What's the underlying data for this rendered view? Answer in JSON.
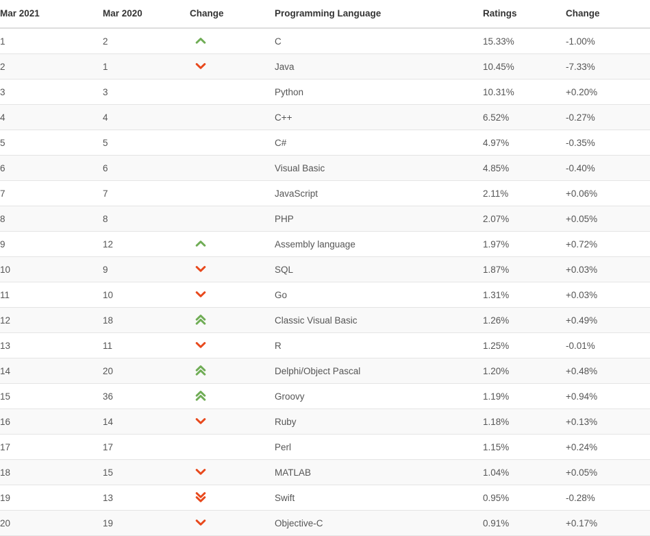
{
  "table": {
    "columns": [
      {
        "key": "rank2021",
        "label": "Mar 2021"
      },
      {
        "key": "rank2020",
        "label": "Mar 2020"
      },
      {
        "key": "change",
        "label": "Change"
      },
      {
        "key": "language",
        "label": "Programming Language"
      },
      {
        "key": "ratings",
        "label": "Ratings"
      },
      {
        "key": "delta",
        "label": "Change"
      }
    ],
    "colors": {
      "up_arrow": "#70ad56",
      "down_arrow": "#e8491d",
      "header_text": "#333333",
      "body_text": "#555555",
      "stripe": "#f9f9f9",
      "row_border": "#e4e4e4",
      "header_border": "#dddddd"
    },
    "icons": {
      "up_single": "chevron-up-icon",
      "up_double": "chevron-double-up-icon",
      "down_single": "chevron-down-icon",
      "down_double": "chevron-double-down-icon",
      "none": ""
    },
    "rows": [
      {
        "rank2021": "1",
        "rank2020": "2",
        "change": "up-single",
        "language": "C",
        "ratings": "15.33%",
        "delta": "-1.00%"
      },
      {
        "rank2021": "2",
        "rank2020": "1",
        "change": "down-single",
        "language": "Java",
        "ratings": "10.45%",
        "delta": "-7.33%"
      },
      {
        "rank2021": "3",
        "rank2020": "3",
        "change": "none",
        "language": "Python",
        "ratings": "10.31%",
        "delta": "+0.20%"
      },
      {
        "rank2021": "4",
        "rank2020": "4",
        "change": "none",
        "language": "C++",
        "ratings": "6.52%",
        "delta": "-0.27%"
      },
      {
        "rank2021": "5",
        "rank2020": "5",
        "change": "none",
        "language": "C#",
        "ratings": "4.97%",
        "delta": "-0.35%"
      },
      {
        "rank2021": "6",
        "rank2020": "6",
        "change": "none",
        "language": "Visual Basic",
        "ratings": "4.85%",
        "delta": "-0.40%"
      },
      {
        "rank2021": "7",
        "rank2020": "7",
        "change": "none",
        "language": "JavaScript",
        "ratings": "2.11%",
        "delta": "+0.06%"
      },
      {
        "rank2021": "8",
        "rank2020": "8",
        "change": "none",
        "language": "PHP",
        "ratings": "2.07%",
        "delta": "+0.05%"
      },
      {
        "rank2021": "9",
        "rank2020": "12",
        "change": "up-single",
        "language": "Assembly language",
        "ratings": "1.97%",
        "delta": "+0.72%"
      },
      {
        "rank2021": "10",
        "rank2020": "9",
        "change": "down-single",
        "language": "SQL",
        "ratings": "1.87%",
        "delta": "+0.03%"
      },
      {
        "rank2021": "11",
        "rank2020": "10",
        "change": "down-single",
        "language": "Go",
        "ratings": "1.31%",
        "delta": "+0.03%"
      },
      {
        "rank2021": "12",
        "rank2020": "18",
        "change": "up-double",
        "language": "Classic Visual Basic",
        "ratings": "1.26%",
        "delta": "+0.49%"
      },
      {
        "rank2021": "13",
        "rank2020": "11",
        "change": "down-single",
        "language": "R",
        "ratings": "1.25%",
        "delta": "-0.01%"
      },
      {
        "rank2021": "14",
        "rank2020": "20",
        "change": "up-double",
        "language": "Delphi/Object Pascal",
        "ratings": "1.20%",
        "delta": "+0.48%"
      },
      {
        "rank2021": "15",
        "rank2020": "36",
        "change": "up-double",
        "language": "Groovy",
        "ratings": "1.19%",
        "delta": "+0.94%"
      },
      {
        "rank2021": "16",
        "rank2020": "14",
        "change": "down-single",
        "language": "Ruby",
        "ratings": "1.18%",
        "delta": "+0.13%"
      },
      {
        "rank2021": "17",
        "rank2020": "17",
        "change": "none",
        "language": "Perl",
        "ratings": "1.15%",
        "delta": "+0.24%"
      },
      {
        "rank2021": "18",
        "rank2020": "15",
        "change": "down-single",
        "language": "MATLAB",
        "ratings": "1.04%",
        "delta": "+0.05%"
      },
      {
        "rank2021": "19",
        "rank2020": "13",
        "change": "down-double",
        "language": "Swift",
        "ratings": "0.95%",
        "delta": "-0.28%"
      },
      {
        "rank2021": "20",
        "rank2020": "19",
        "change": "down-single",
        "language": "Objective-C",
        "ratings": "0.91%",
        "delta": "+0.17%"
      }
    ]
  }
}
